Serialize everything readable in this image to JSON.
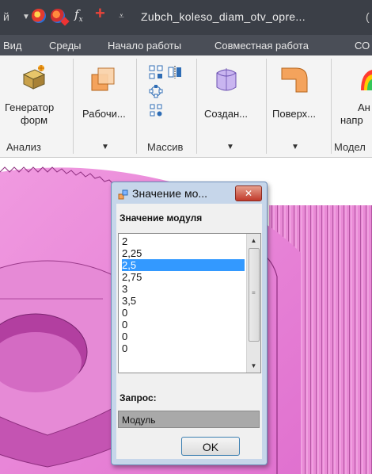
{
  "titlebar": {
    "cut_text": "й",
    "fx_label": "f",
    "fx_sub": "x",
    "title": "Zubch_koleso_diam_otv_opre...",
    "right_text": "("
  },
  "tabs": [
    "Вид",
    "Среды",
    "Начало работы",
    "Совместная работа",
    "СО"
  ],
  "ribbon": {
    "generator_label_1": "Генератор",
    "generator_label_2": "форм",
    "analysis_group": "Анализ",
    "work_label": "Рабочи...",
    "array_group": "Массив",
    "create_label": "Создан...",
    "surface_label": "Поверх...",
    "right_label_1": "Ан",
    "right_label_2": "напр",
    "model_group": "Модел"
  },
  "dialog": {
    "title": "Значение мо...",
    "close_label": "✕",
    "list_label": "Значение модуля",
    "items": [
      "2",
      "2,25",
      "2,5",
      "2,75",
      "3",
      "3,5",
      "0",
      "0",
      "0",
      "0"
    ],
    "selected_index": 2,
    "query_label": "Запрос:",
    "query_value": "Модуль",
    "ok_label": "OK"
  },
  "colors": {
    "gear_pink": "#e87fd4",
    "gear_dark": "#b23fa0",
    "selection": "#3399ff",
    "titlebar": "#3b3f47"
  }
}
